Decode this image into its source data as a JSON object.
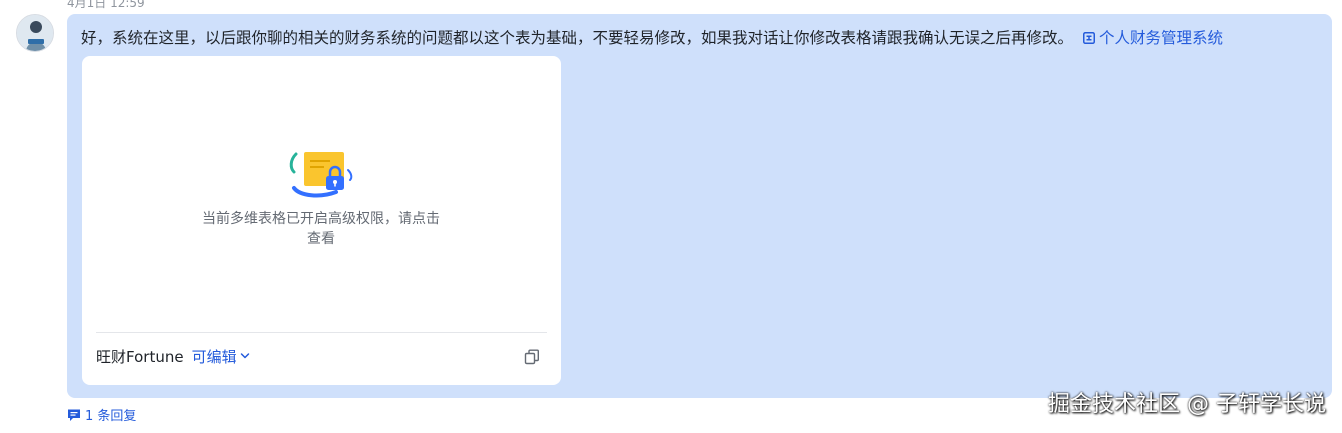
{
  "message": {
    "timestamp": "4月1日 12:59",
    "text": "好，系统在这里，以后跟你聊的相关的财务系统的问题都以这个表为基础，不要轻易修改，如果我对话让你修改表格请跟我确认无误之后再修改。",
    "doc_link_label": "个人财务管理系统"
  },
  "card": {
    "notice": "当前多维表格已开启高级权限，请点击查看",
    "owner": "旺财Fortune",
    "permission": "可编辑"
  },
  "reply": {
    "label": "1 条回复"
  },
  "watermark": "掘金技术社区 @ 子轩学长说",
  "icons": {
    "doc_link": "bitable-icon",
    "lock": "lock-illustration",
    "chevron": "chevron-down-icon",
    "copy": "copy-icon",
    "reply": "comment-icon"
  },
  "colors": {
    "bubble": "#cfe0fb",
    "link": "#245bdb",
    "card": "#ffffff"
  }
}
